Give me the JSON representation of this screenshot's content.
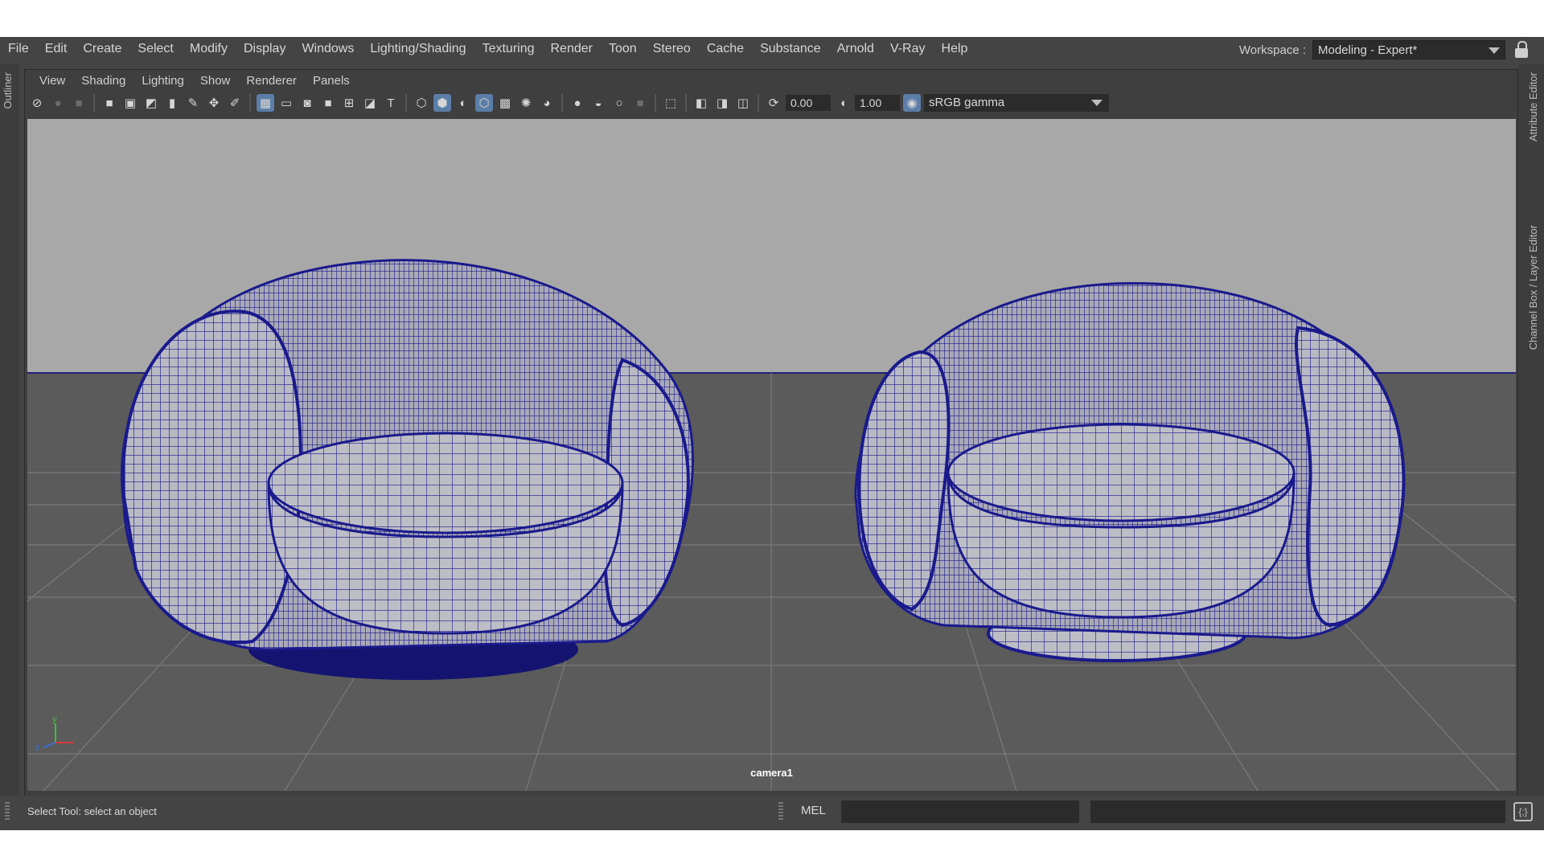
{
  "main_menu": [
    "File",
    "Edit",
    "Create",
    "Select",
    "Modify",
    "Display",
    "Windows",
    "Lighting/Shading",
    "Texturing",
    "Render",
    "Toon",
    "Stereo",
    "Cache",
    "Substance",
    "Arnold",
    "V-Ray",
    "Help"
  ],
  "workspace": {
    "label": "Workspace :",
    "value": "Modeling - Expert*"
  },
  "side_tabs": {
    "outliner": "Outliner",
    "attribute_editor": "Attribute Editor",
    "channel_box": "Channel Box / Layer Editor"
  },
  "panel_menu": [
    "View",
    "Shading",
    "Lighting",
    "Show",
    "Renderer",
    "Panels"
  ],
  "toolbar": {
    "exposure": "0.00",
    "gamma": "1.00",
    "color_space": "sRGB gamma"
  },
  "viewport": {
    "camera_label": "camera1",
    "axis_x": "z",
    "axis_y": "y"
  },
  "status": {
    "help_line": "Select Tool: select an object",
    "command_language": "MEL"
  },
  "colors": {
    "wireframe": "#1a1a8c",
    "background_top": "#a8a8a8",
    "floor": "#5a5a5a"
  }
}
